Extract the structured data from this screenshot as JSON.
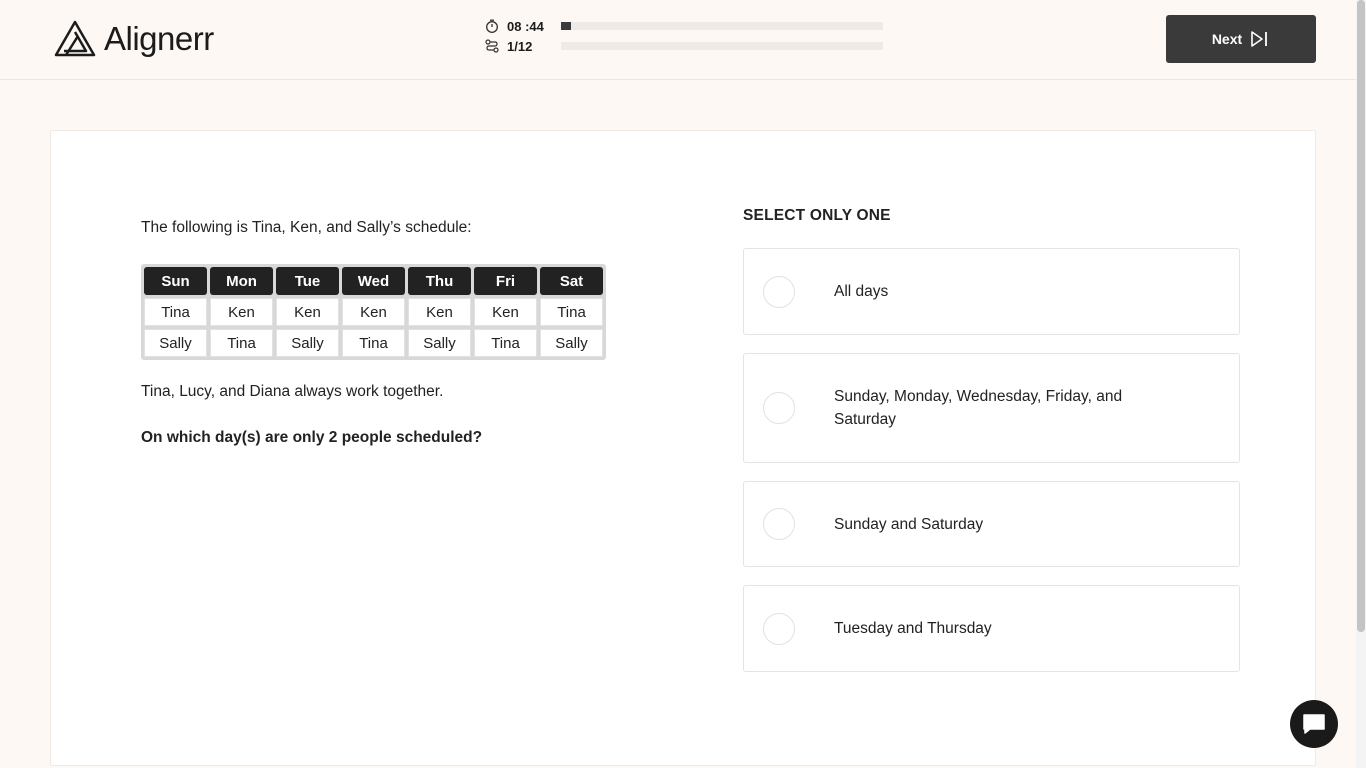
{
  "header": {
    "brand": "Aligner",
    "brand_suffix": "r",
    "timer": "08 :44",
    "question_counter": "1/12",
    "timer_progress": 0.03,
    "question_progress": 0.0,
    "next_label": "Next"
  },
  "question": {
    "intro": "The following is Tina, Ken, and Sally’s schedule:",
    "schedule": {
      "headers": [
        "Sun",
        "Mon",
        "Tue",
        "Wed",
        "Thu",
        "Fri",
        "Sat"
      ],
      "rows": [
        [
          "Tina",
          "Ken",
          "Ken",
          "Ken",
          "Ken",
          "Ken",
          "Tina"
        ],
        [
          "Sally",
          "Tina",
          "Sally",
          "Tina",
          "Sally",
          "Tina",
          "Sally"
        ]
      ]
    },
    "note": "Tina, Lucy, and Diana always work together.",
    "prompt": "On which day(s) are only 2 people scheduled?"
  },
  "answers": {
    "instruction": "SELECT ONLY ONE",
    "options": [
      "All days",
      "Sunday, Monday, Wednesday, Friday, and Saturday",
      "Sunday and Saturday",
      "Tuesday and Thursday"
    ]
  },
  "colors": {
    "accent": "#3a3a3a",
    "background": "#fdf8f4"
  }
}
